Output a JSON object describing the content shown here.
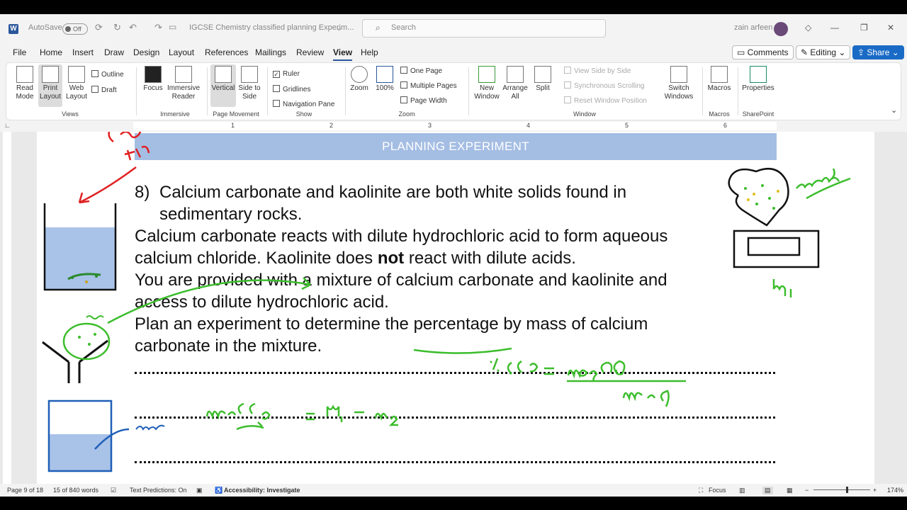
{
  "titlebar": {
    "autosave_label": "AutoSave",
    "autosave_state": "Off",
    "doc_title": "IGCSE Chemistry classified planning Experim...",
    "search_placeholder": "Search",
    "user_name": "zain arfeen"
  },
  "menu": [
    "File",
    "Home",
    "Insert",
    "Draw",
    "Design",
    "Layout",
    "References",
    "Mailings",
    "Review",
    "View",
    "Help"
  ],
  "menu_active": "View",
  "top_buttons": {
    "comments": "Comments",
    "editing": "Editing",
    "share": "Share"
  },
  "ribbon": {
    "views": {
      "read_mode": "Read Mode",
      "print_layout": "Print Layout",
      "web_layout": "Web Layout",
      "outline": "Outline",
      "draft": "Draft",
      "group": "Views"
    },
    "immersive": {
      "focus": "Focus",
      "immersive_reader": "Immersive Reader",
      "group": "Immersive"
    },
    "page_movement": {
      "vertical": "Vertical",
      "side_to_side": "Side to Side",
      "group": "Page Movement"
    },
    "show": {
      "ruler": "Ruler",
      "gridlines": "Gridlines",
      "navigation_pane": "Navigation Pane",
      "group": "Show"
    },
    "zoom": {
      "zoom": "Zoom",
      "hundred": "100%",
      "one_page": "One Page",
      "multiple_pages": "Multiple Pages",
      "page_width": "Page Width",
      "group": "Zoom"
    },
    "window": {
      "new_window": "New Window",
      "arrange_all": "Arrange All",
      "split": "Split",
      "view_side_by_side": "View Side by Side",
      "sync_scrolling": "Synchronous Scrolling",
      "reset_window": "Reset Window Position",
      "switch_windows": "Switch Windows",
      "group": "Window"
    },
    "macros": {
      "macros": "Macros",
      "group": "Macros"
    },
    "sharepoint": {
      "properties": "Properties",
      "group": "SharePoint"
    }
  },
  "ruler_ticks": [
    "1",
    "2",
    "3",
    "4",
    "5",
    "6"
  ],
  "document": {
    "banner": "PLANNING EXPERIMENT",
    "q_number": "8)",
    "line1": "Calcium carbonate and kaolinite are both white solids found in",
    "line2": "sedimentary rocks.",
    "line3": "Calcium carbonate reacts with dilute hydrochloric acid to form aqueous",
    "line4_a": "calcium chloride. Kaolinite does ",
    "line4_bold": "not",
    "line4_b": " react with dilute acids.",
    "line5": "You are provided with a mixture of calcium carbonate and kaolinite and",
    "line6": "access to dilute hydrochloric acid.",
    "line7": "Plan an experiment to determine the percentage by mass of calcium",
    "line8": "carbonate in the mixture."
  },
  "status": {
    "page": "Page 9 of 18",
    "words": "15 of 840 words",
    "text_predictions": "Text Predictions: On",
    "accessibility": "Accessibility: Investigate",
    "focus": "Focus",
    "zoom": "174%"
  },
  "colors": {
    "accent": "#2b579a",
    "banner": "#a4bde3",
    "ink_green": "#3cbd2c",
    "ink_red": "#e02020",
    "ink_blue": "#1f5fb8",
    "water": "#a9c2e8"
  }
}
